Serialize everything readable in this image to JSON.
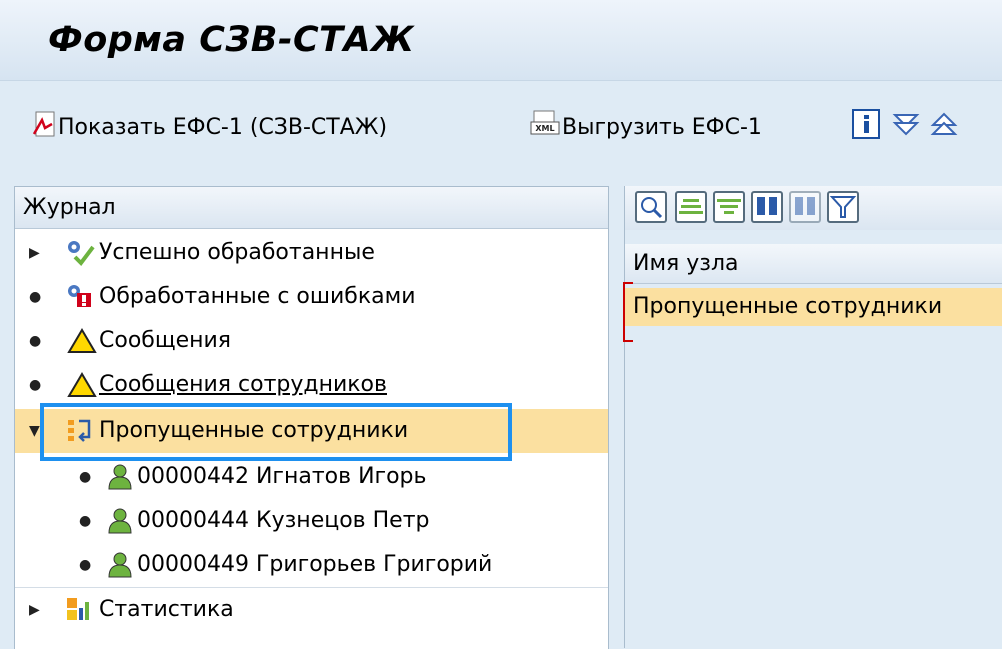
{
  "window": {
    "title": "Форма СЗВ-СТАЖ"
  },
  "toolbar": {
    "show_efs_label": "Показать ЕФС-1 (СЗВ-СТАЖ)",
    "export_efs_label": "Выгрузить ЕФС-1",
    "xml_icon_text": "XML"
  },
  "left_panel": {
    "header": "Журнал",
    "items": [
      {
        "label": "Успешно обработанные",
        "icon": "gears-check-icon"
      },
      {
        "label": "Обработанные с ошибками",
        "icon": "gears-error-icon"
      },
      {
        "label": "Сообщения",
        "icon": "warning-icon"
      },
      {
        "label": "Сообщения сотрудников",
        "icon": "warning-icon"
      },
      {
        "label": "Пропущенные сотрудники",
        "icon": "skipped-icon",
        "selected": true
      },
      {
        "label": "00000442 Игнатов Игорь",
        "icon": "person-icon"
      },
      {
        "label": "00000444 Кузнецов Петр",
        "icon": "person-icon"
      },
      {
        "label": "00000449 Григорьев Григорий",
        "icon": "person-icon"
      },
      {
        "label": "Статистика",
        "icon": "statistics-icon"
      }
    ]
  },
  "right_panel": {
    "column_header": "Имя узла",
    "row_value": "Пропущенные сотрудники"
  },
  "colors": {
    "background": "#dfebf5",
    "selection": "#fbe0a0",
    "highlight_border": "#1e90ef"
  }
}
